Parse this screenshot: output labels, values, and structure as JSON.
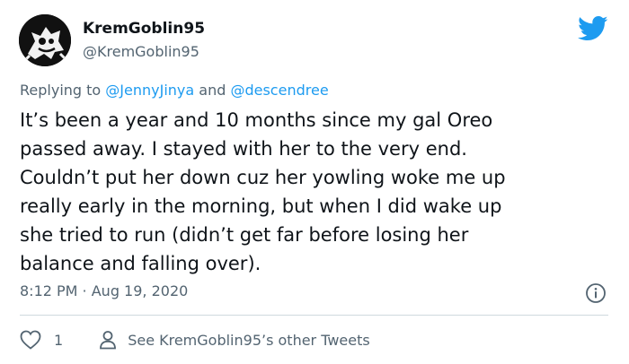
{
  "author": {
    "display_name": "KremGoblin95",
    "handle": "@KremGoblin95",
    "avatar_icon": "cartoon-character-avatar"
  },
  "reply": {
    "prefix": "Replying to ",
    "mention_1": "@JennyJinya",
    "joiner": " and ",
    "mention_2": "@descendree"
  },
  "tweet": {
    "text": "It’s been a year and 10 months since my gal Oreo\npassed away. I stayed with her to the very end.\nCouldn’t put her down cuz her yowling woke me up\nreally early in the morning, but when I did wake up\nshe tried to run (didn’t get far before losing her\nbalance and falling over).",
    "timestamp": "8:12 PM · Aug 19, 2020"
  },
  "actions": {
    "like_count": "1",
    "see_more_label": "See KremGoblin95’s other Tweets"
  },
  "colors": {
    "brand": "#1d9bf0",
    "secondary_text": "#536471",
    "primary_text": "#0f1419",
    "divider": "#cfd9de"
  },
  "icons": {
    "logo": "twitter-bird-icon",
    "info": "info-icon",
    "like": "heart-icon",
    "profile": "person-icon"
  }
}
